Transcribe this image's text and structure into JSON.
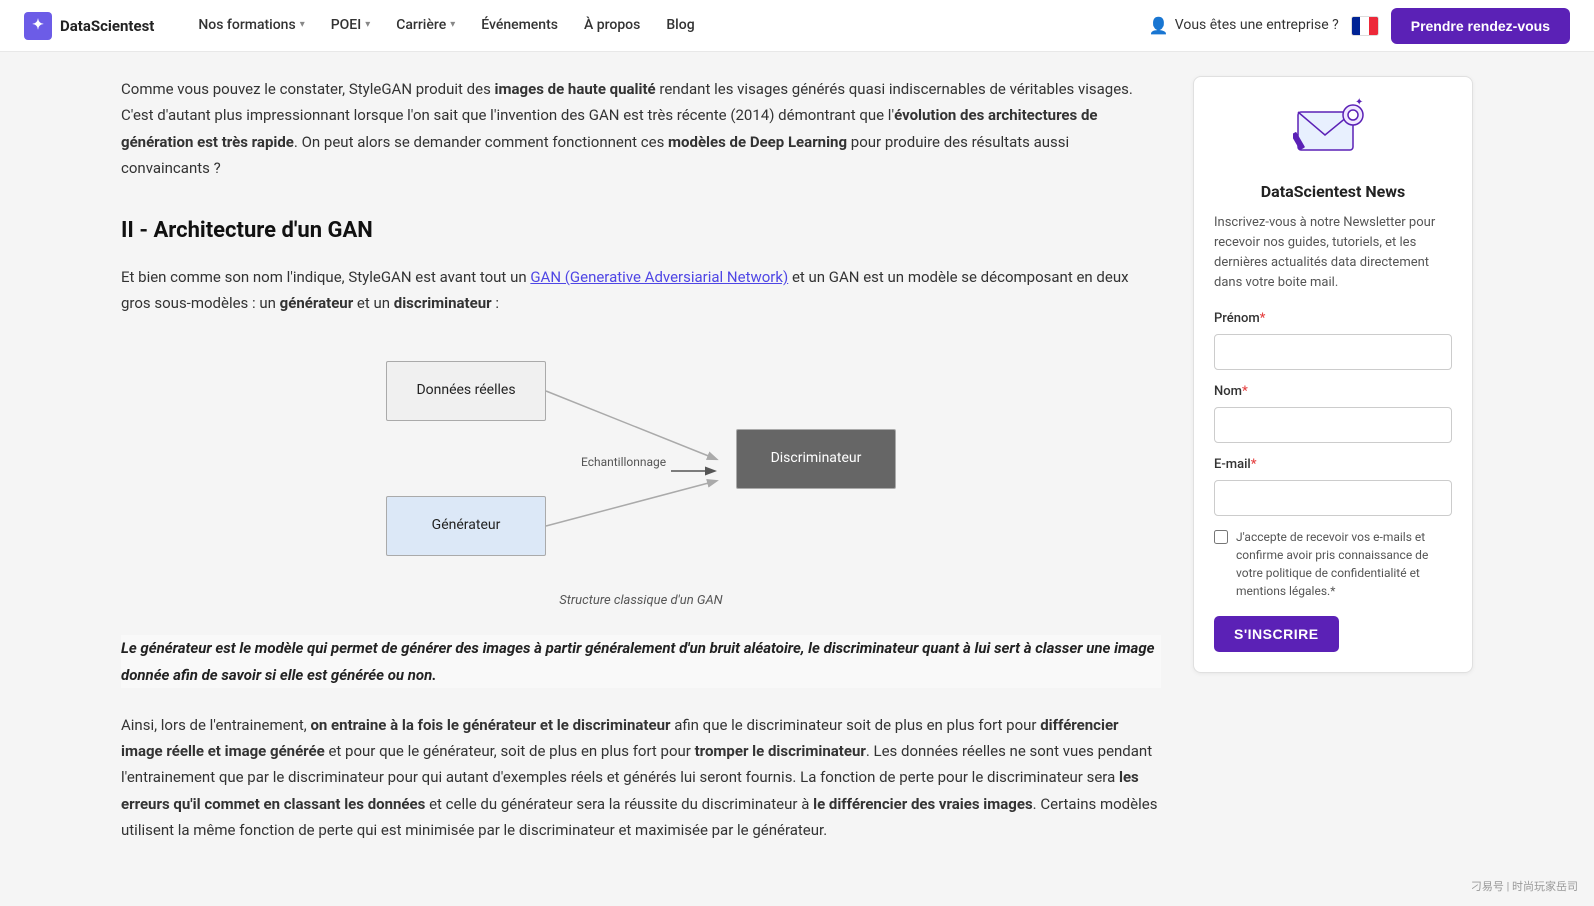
{
  "navbar": {
    "logo_text": "DataScientest",
    "nav_items": [
      {
        "label": "Nos formations",
        "has_dropdown": true
      },
      {
        "label": "POEI",
        "has_dropdown": true
      },
      {
        "label": "Carrière",
        "has_dropdown": true
      },
      {
        "label": "Événements",
        "has_dropdown": false
      },
      {
        "label": "À propos",
        "has_dropdown": false
      },
      {
        "label": "Blog",
        "has_dropdown": false
      }
    ],
    "enterprise_label": "Vous êtes une entreprise ?",
    "cta_label": "Prendre rendez-vous"
  },
  "article": {
    "intro": "Comme vous pouvez le constater, StyleGAN produit des images de haute qualité rendant les visages générés quasi indiscernables de véritables visages. C'est d'autant plus impressionnant lorsque l'on sait que l'invention des GAN est très récente (2014) démontrant que l'évolution des architectures de génération est très rapide. On peut alors se demander comment fonctionnent ces modèles de Deep Learning pour produire des résultats aussi convaincants ?",
    "section_title": "II - Architecture d'un GAN",
    "section_text1_before": "Et bien comme son nom l'indique, StyleGAN est avant tout un ",
    "section_link": "GAN (Generative Adversiarial Network)",
    "section_text1_after": " et un GAN est un modèle se décomposant en deux gros sous-modèles : un ",
    "generateur_bold": "générateur",
    "and_text": " et un ",
    "discriminateur_bold": "discriminateur",
    "colon": " :",
    "diagram": {
      "box_donnees": "Données réelles",
      "box_generateur": "Générateur",
      "box_discriminateur": "Discriminateur",
      "arrow_label": "Echantillonnage",
      "caption": "Structure classique d'un GAN"
    },
    "blockquote": "Le générateur est le modèle qui permet de générer des images à partir généralement d'un bruit aléatoire, le discriminateur quant à lui sert à classer une image donnée afin de savoir si elle est générée ou non.",
    "para3_before": "Ainsi, lors de l'entrainement, ",
    "para3_bold1": "on entraine à la fois le générateur et le discriminateur",
    "para3_after1": " afin que le discriminateur soit de plus en plus fort pour ",
    "para3_bold2": "différencier image réelle et image générée",
    "para3_after2": " et pour que le générateur, soit de plus en plus fort pour ",
    "para3_bold3": "tromper le discriminateur",
    "para3_after3": ". Les données réelles ne sont vues pendant l'entrainement que par le discriminateur pour qui autant d'exemples réels et générés lui seront fournis. La fonction de perte pour le discriminateur sera ",
    "para3_bold4": "les erreurs qu'il commet en classant les données",
    "para3_after4": " et celle du générateur sera la réussite du discriminateur à ",
    "para3_bold5": "le différencier des vraies images",
    "para3_after5": ". Certains modèles utilisent la même fonction de perte qui est minimisée par le discriminateur et maximisée par le générateur."
  },
  "sidebar": {
    "newsletter_title": "DataScientest News",
    "newsletter_desc": "Inscrivez-vous à notre Newsletter pour recevoir nos guides, tutoriels, et les dernières actualités data directement dans votre boite mail.",
    "form": {
      "prenom_label": "Prénom",
      "prenom_required": "*",
      "prenom_placeholder": "",
      "nom_label": "Nom",
      "nom_required": "*",
      "nom_placeholder": "",
      "email_label": "E-mail",
      "email_required": "*",
      "email_placeholder": "",
      "check_text": "J'accepte de recevoir vos e-mails et confirme avoir pris connaissance de votre politique de confidentialité et mentions légales.",
      "check_required": "*",
      "submit_label": "S'INSCRIRE"
    }
  },
  "watermark": "刁易号 | 时尚玩家岳司"
}
